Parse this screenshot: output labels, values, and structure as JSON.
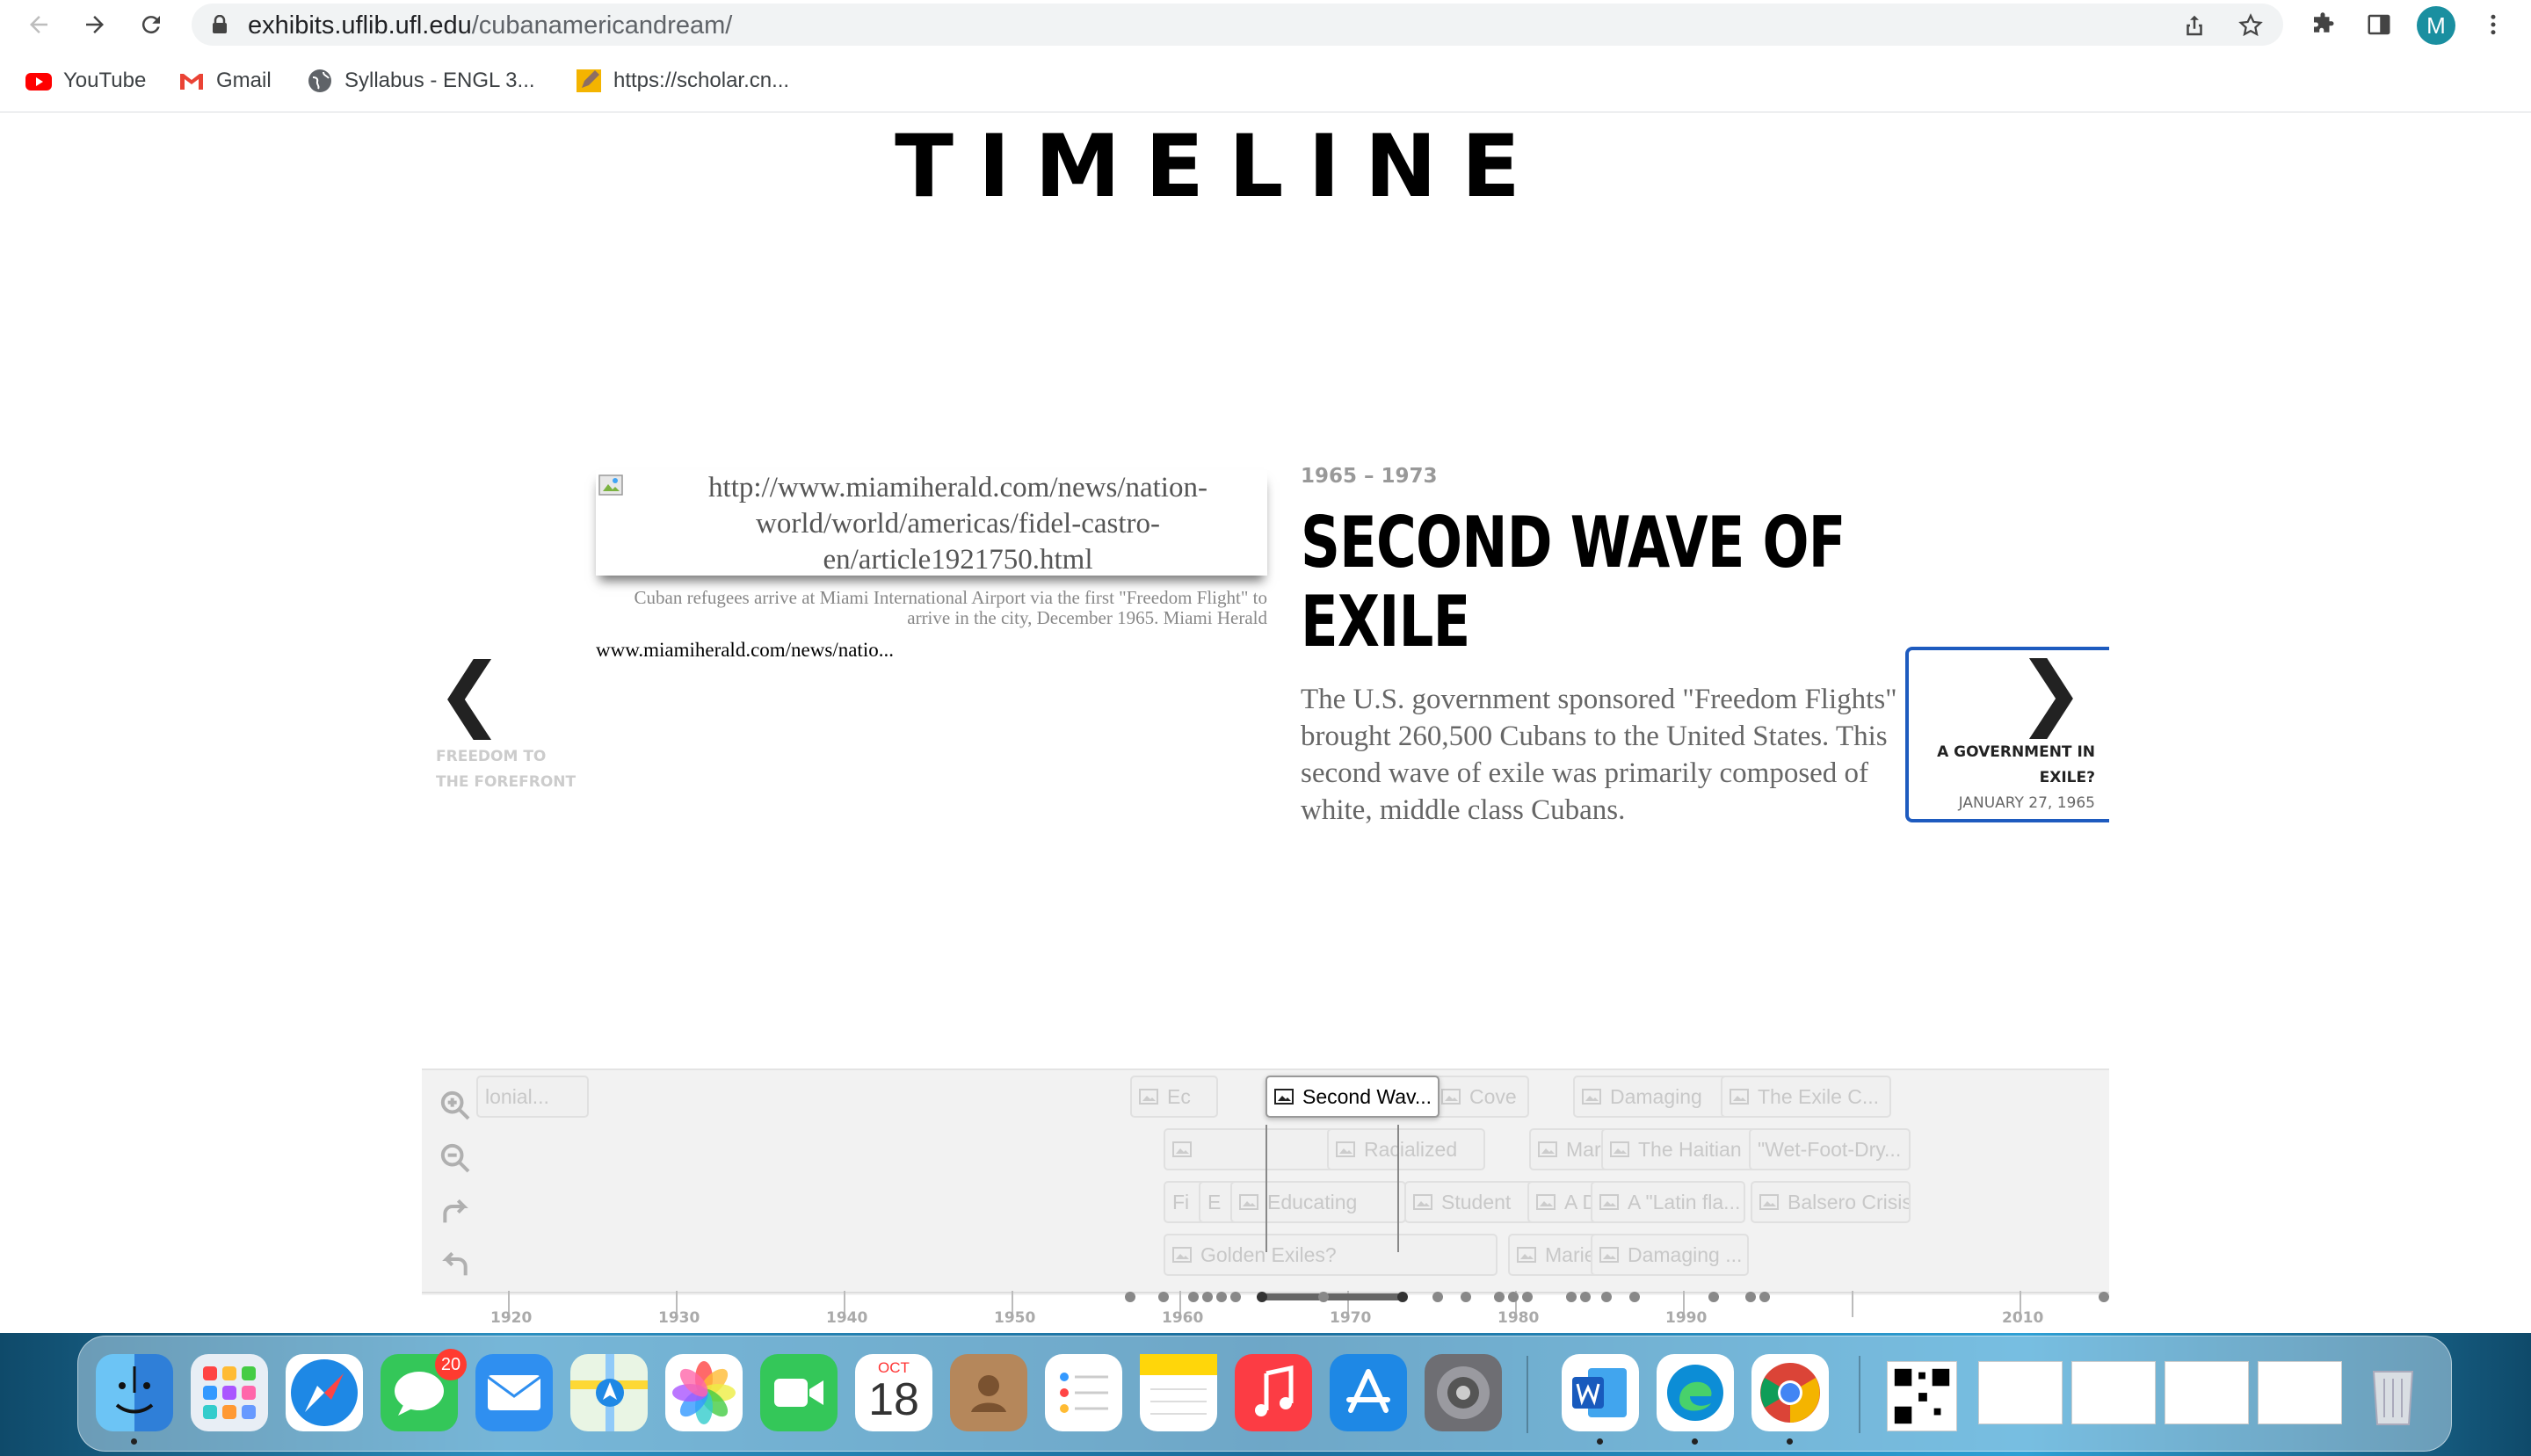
{
  "browser": {
    "url_host": "exhibits.uflib.ufl.edu",
    "url_path": "/cubanamericandream/",
    "profile_initial": "M",
    "bookmarks": [
      {
        "label": "YouTube",
        "icon": "youtube-icon"
      },
      {
        "label": "Gmail",
        "icon": "gmail-icon"
      },
      {
        "label": "Syllabus - ENGL 3...",
        "icon": "globe-icon"
      },
      {
        "label": "https://scholar.cn...",
        "icon": "pencil-icon"
      }
    ]
  },
  "page": {
    "title": "TIMELINE"
  },
  "slide": {
    "image_alt": "http://www.miamiherald.com/news/nation-world/world/americas/fidel-castro-en/article1921750.html",
    "caption": "Cuban refugees arrive at Miami International Airport via the first \"Freedom Flight\" to arrive in the city, December 1965. Miami Herald",
    "credit": "www.miamiherald.com/news/natio...",
    "date": "1965 – 1973",
    "headline": "SECOND WAVE OF EXILE",
    "body": "The U.S. government sponsored \"Freedom Flights\" brought 260,500 Cubans to the United States. This second wave of exile was primarily composed of white, middle class Cubans."
  },
  "nav": {
    "prev_title": "FREEDOM TO THE FOREFRONT",
    "next_title": "A GOVERNMENT IN EXILE?",
    "next_date": "JANUARY 27, 1965",
    "arrow_prev": "❮",
    "arrow_next": "❯"
  },
  "timenav": {
    "active_marker": "Second Wav...",
    "markers_row1": [
      "lonial...",
      "Ec",
      "Cove",
      "Damaging",
      "The Exile C..."
    ],
    "markers_row2": [
      "Racialized",
      "Mari",
      "The Haitian",
      "\"Wet-Foot-Dry..."
    ],
    "markers_row3": [
      "Fi",
      "E",
      "Educating",
      "Student",
      "A D",
      "A \"Latin fla...",
      "Balsero Crisis"
    ],
    "markers_row4": [
      "Golden Exiles?",
      "Mariel E",
      "Damaging ..."
    ],
    "axis_labels": [
      "1920",
      "1930",
      "1940",
      "1950",
      "1960",
      "1970",
      "1980",
      "1990",
      "2010"
    ]
  },
  "dock": {
    "calendar_month": "OCT",
    "calendar_day": "18",
    "messages_badge": "20",
    "apps": [
      "finder-icon",
      "launchpad-icon",
      "safari-icon",
      "messages-icon",
      "mail-icon",
      "maps-icon",
      "photos-icon",
      "facetime-icon",
      "calendar-icon",
      "contacts-icon",
      "reminders-icon",
      "notes-icon",
      "music-icon",
      "app-store-icon",
      "system-preferences-icon",
      "word-icon",
      "edge-icon",
      "chrome-icon"
    ]
  }
}
